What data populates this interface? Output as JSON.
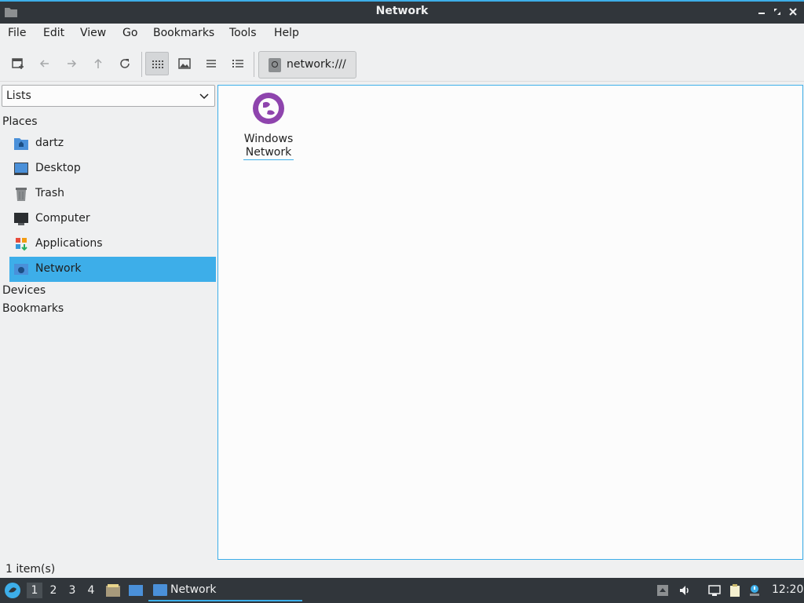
{
  "window": {
    "title": "Network"
  },
  "menu": [
    "File",
    "Edit",
    "View",
    "Go",
    "Bookmarks",
    "Tools",
    "Help"
  ],
  "toolbar": {
    "icons": [
      "new-tab-icon",
      "back-icon",
      "forward-icon",
      "up-icon",
      "reload-icon",
      "icon-view-icon",
      "thumbnail-view-icon",
      "compact-view-icon",
      "detailed-list-icon"
    ],
    "location": "network:///"
  },
  "sidepane": {
    "combo_value": "Lists",
    "places_header": "Places",
    "places": [
      {
        "label": "dartz",
        "icon": "home-folder-icon"
      },
      {
        "label": "Desktop",
        "icon": "desktop-icon"
      },
      {
        "label": "Trash",
        "icon": "trash-icon"
      },
      {
        "label": "Computer",
        "icon": "computer-icon"
      },
      {
        "label": "Applications",
        "icon": "applications-icon"
      },
      {
        "label": "Network",
        "icon": "network-icon",
        "selected": true
      }
    ],
    "devices_header": "Devices",
    "bookmarks_header": "Bookmarks"
  },
  "main": {
    "items": [
      {
        "line1": "Windows",
        "line2": "Network",
        "icon": "windows-network-icon"
      }
    ]
  },
  "status": {
    "text": "1 item(s)"
  },
  "panel": {
    "workspaces": [
      "1",
      "2",
      "3",
      "4"
    ],
    "active_workspace": "1",
    "task_label": "Network",
    "clock": "12:20"
  },
  "colors": {
    "accent": "#3daee9",
    "titlebar": "#31363b",
    "network_purple": "#8e44ad"
  }
}
